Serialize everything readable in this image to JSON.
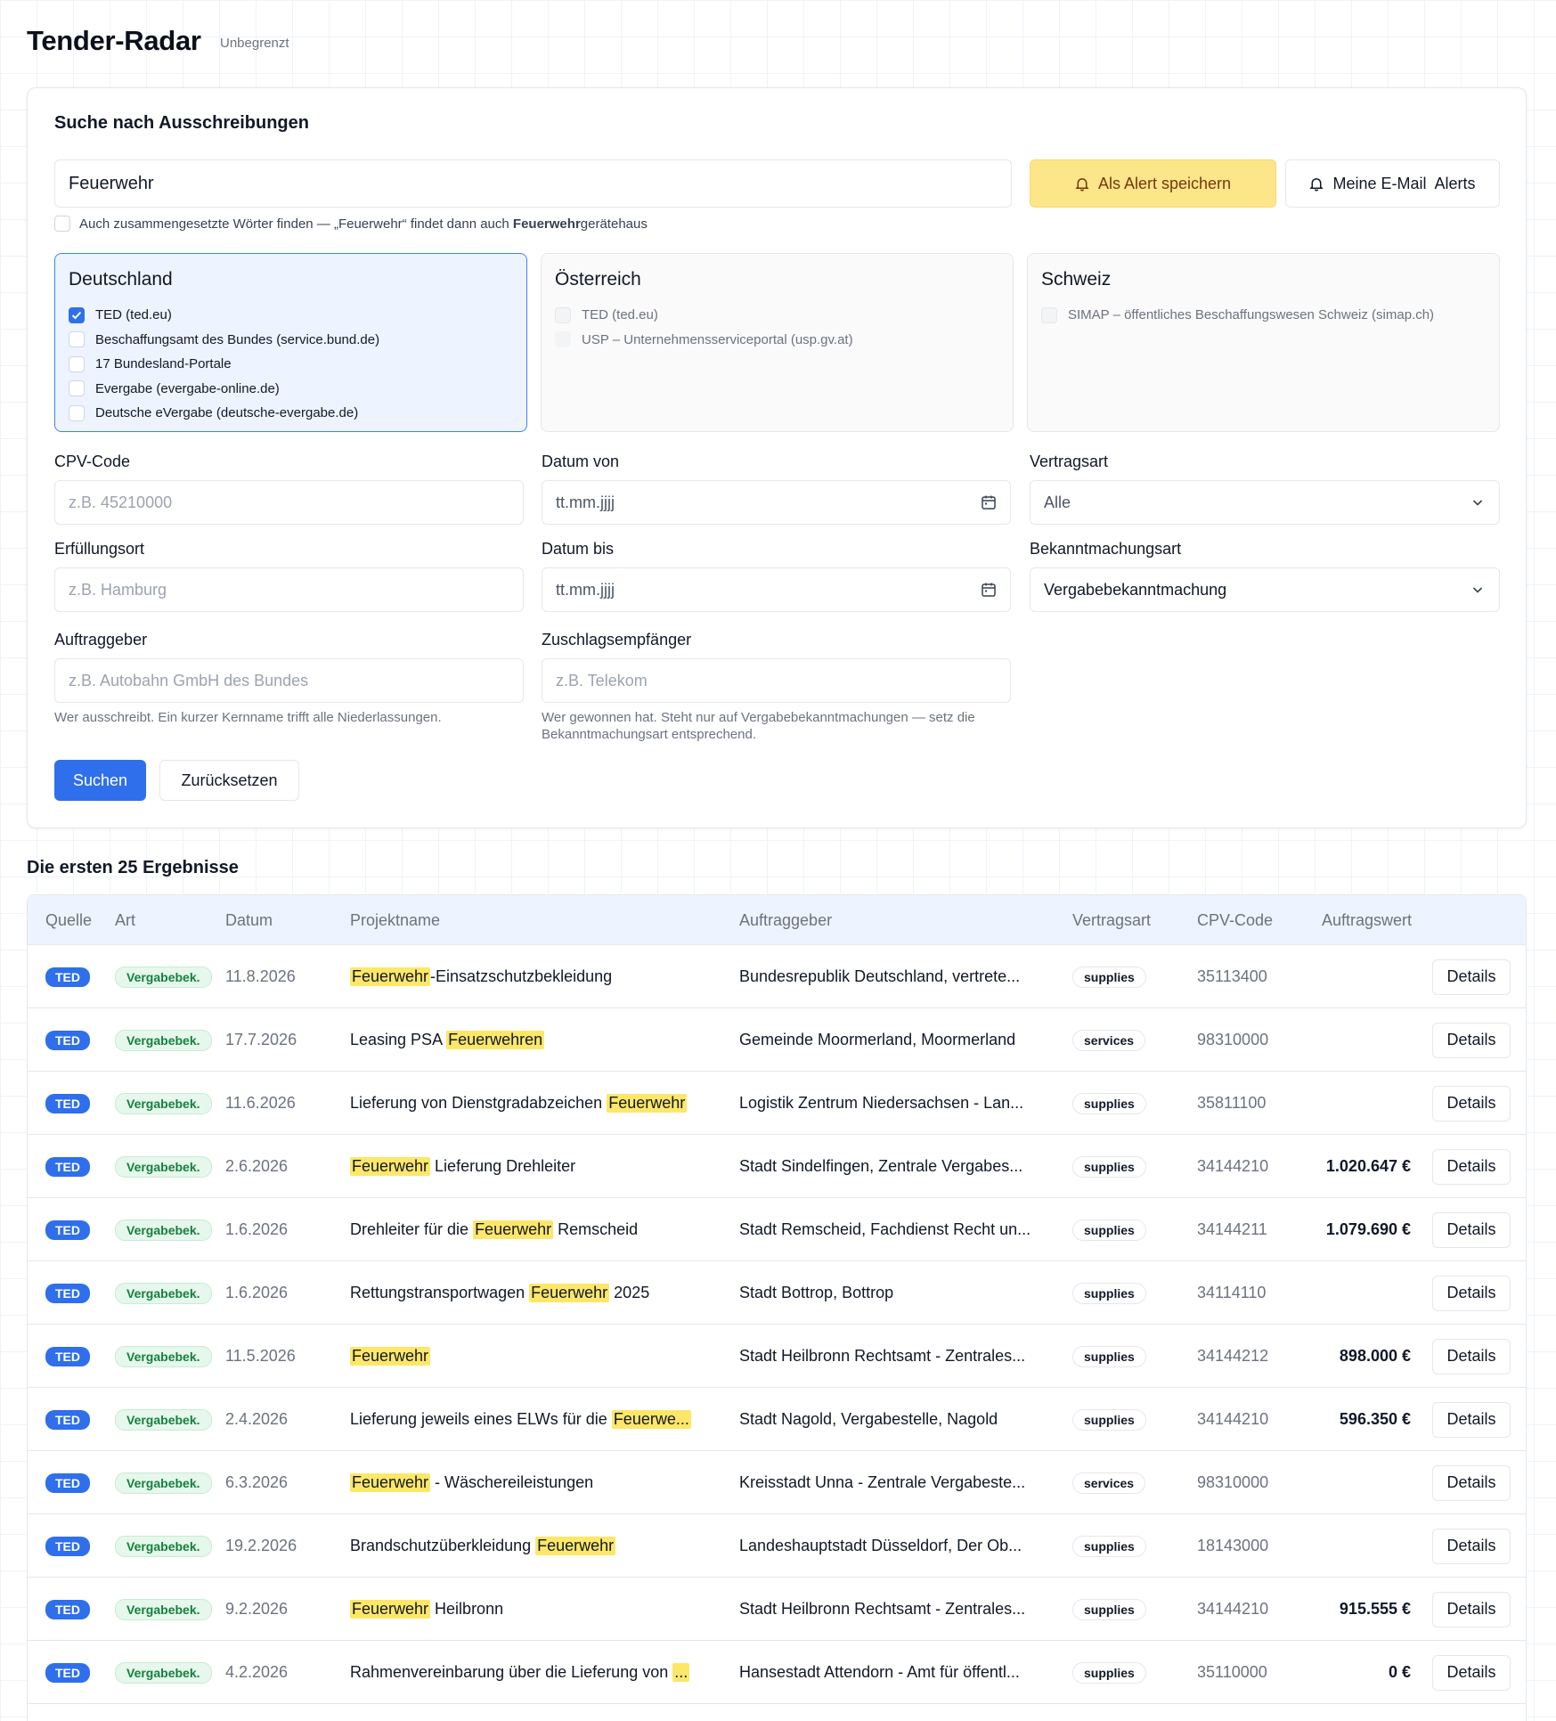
{
  "header": {
    "title": "Tender-Radar",
    "plan": "Unbegrenzt"
  },
  "search": {
    "heading": "Suche nach Ausschreibungen",
    "query": "Feuerwehr",
    "alert_button": "Als Alert speichern",
    "email_alerts_button": "Meine E-Mail  Alerts",
    "compound_label_pre": "Auch zusammengesetzte Wörter finden — „Feuerwehr“ findet dann auch ",
    "compound_label_bold": "Feuerwehr",
    "compound_label_post": "gerätehaus",
    "compound_checked": false
  },
  "countries": [
    {
      "name": "Deutschland",
      "active": true,
      "sources": [
        {
          "label": "TED (ted.eu)",
          "checked": true
        },
        {
          "label": "Beschaffungsamt des Bundes (service.bund.de)",
          "checked": false
        },
        {
          "label": "17 Bundesland-Portale",
          "checked": false
        },
        {
          "label": "Evergabe (evergabe-online.de)",
          "checked": false
        },
        {
          "label": "Deutsche eVergabe (deutsche-evergabe.de)",
          "checked": false
        }
      ]
    },
    {
      "name": "Österreich",
      "active": false,
      "sources": [
        {
          "label": "TED (ted.eu)",
          "checked": false
        },
        {
          "label": "USP – Unternehmensserviceportal (usp.gv.at)",
          "checked": false
        }
      ]
    },
    {
      "name": "Schweiz",
      "active": false,
      "sources": [
        {
          "label": "SIMAP – öffentliches Beschaffungswesen Schweiz (simap.ch)",
          "checked": false
        }
      ]
    }
  ],
  "fields": {
    "cpv": {
      "label": "CPV-Code",
      "placeholder": "z.B. 45210000"
    },
    "date_from": {
      "label": "Datum von",
      "placeholder": "tt.mm.jjjj"
    },
    "contract_type": {
      "label": "Vertragsart",
      "value": "Alle"
    },
    "place": {
      "label": "Erfüllungsort",
      "placeholder": "z.B. Hamburg"
    },
    "date_to": {
      "label": "Datum bis",
      "placeholder": "tt.mm.jjjj"
    },
    "notice_type": {
      "label": "Bekanntmachungsart",
      "value": "Vergabebekanntmachung"
    },
    "buyer": {
      "label": "Auftraggeber",
      "placeholder": "z.B. Autobahn GmbH des Bundes",
      "help": "Wer ausschreibt. Ein kurzer Kernname trifft alle Niederlassungen."
    },
    "winner": {
      "label": "Zuschlagsempfänger",
      "placeholder": "z.B. Telekom",
      "help": "Wer gewonnen hat. Steht nur auf Vergabebekanntmachungen — setz die Bekanntmachungsart entsprechend."
    }
  },
  "actions": {
    "search": "Suchen",
    "reset": "Zurücksetzen"
  },
  "results": {
    "heading": "Die ersten 25 Ergebnisse",
    "columns": [
      "Quelle",
      "Art",
      "Datum",
      "Projektname",
      "Auftraggeber",
      "Vertragsart",
      "CPV-Code",
      "Auftragswert"
    ],
    "details_label": "Details",
    "rows": [
      {
        "source": "TED",
        "type": "Vergabebek.",
        "date": "11.8.2026",
        "project": [
          {
            "t": "Feuerwehr",
            "h": true
          },
          {
            "t": "-Einsatzschutzbekleidung",
            "h": false
          }
        ],
        "buyer": "Bundesrepublik Deutschland, vertrete...",
        "contract": "supplies",
        "cpv": "35113400",
        "value": ""
      },
      {
        "source": "TED",
        "type": "Vergabebek.",
        "date": "17.7.2026",
        "project": [
          {
            "t": "Leasing PSA ",
            "h": false
          },
          {
            "t": "Feuerwehren",
            "h": true
          }
        ],
        "buyer": "Gemeinde Moormerland, Moormerland",
        "contract": "services",
        "cpv": "98310000",
        "value": ""
      },
      {
        "source": "TED",
        "type": "Vergabebek.",
        "date": "11.6.2026",
        "project": [
          {
            "t": "Lieferung von Dienstgradabzeichen ",
            "h": false
          },
          {
            "t": "Feuerwehr",
            "h": true
          }
        ],
        "buyer": "Logistik Zentrum Niedersachsen - Lan...",
        "contract": "supplies",
        "cpv": "35811100",
        "value": ""
      },
      {
        "source": "TED",
        "type": "Vergabebek.",
        "date": "2.6.2026",
        "project": [
          {
            "t": "Feuerwehr",
            "h": true
          },
          {
            "t": " Lieferung Drehleiter",
            "h": false
          }
        ],
        "buyer": "Stadt Sindelfingen, Zentrale Vergabes...",
        "contract": "supplies",
        "cpv": "34144210",
        "value": "1.020.647 €"
      },
      {
        "source": "TED",
        "type": "Vergabebek.",
        "date": "1.6.2026",
        "project": [
          {
            "t": "Drehleiter für die ",
            "h": false
          },
          {
            "t": "Feuerwehr",
            "h": true
          },
          {
            "t": " Remscheid",
            "h": false
          }
        ],
        "buyer": "Stadt Remscheid, Fachdienst Recht un...",
        "contract": "supplies",
        "cpv": "34144211",
        "value": "1.079.690 €"
      },
      {
        "source": "TED",
        "type": "Vergabebek.",
        "date": "1.6.2026",
        "project": [
          {
            "t": "Rettungstransportwagen ",
            "h": false
          },
          {
            "t": "Feuerwehr",
            "h": true
          },
          {
            "t": " 2025",
            "h": false
          }
        ],
        "buyer": "Stadt Bottrop, Bottrop",
        "contract": "supplies",
        "cpv": "34114110",
        "value": ""
      },
      {
        "source": "TED",
        "type": "Vergabebek.",
        "date": "11.5.2026",
        "project": [
          {
            "t": "Feuerwehr",
            "h": true
          }
        ],
        "buyer": "Stadt Heilbronn Rechtsamt - Zentrales...",
        "contract": "supplies",
        "cpv": "34144212",
        "value": "898.000 €"
      },
      {
        "source": "TED",
        "type": "Vergabebek.",
        "date": "2.4.2026",
        "project": [
          {
            "t": "Lieferung jeweils eines ELWs für die ",
            "h": false
          },
          {
            "t": "Feuerwe...",
            "h": true
          }
        ],
        "buyer": "Stadt Nagold, Vergabestelle, Nagold",
        "contract": "supplies",
        "cpv": "34144210",
        "value": "596.350 €"
      },
      {
        "source": "TED",
        "type": "Vergabebek.",
        "date": "6.3.2026",
        "project": [
          {
            "t": "Feuerwehr",
            "h": true
          },
          {
            "t": " - Wäschereileistungen",
            "h": false
          }
        ],
        "buyer": "Kreisstadt Unna - Zentrale Vergabeste...",
        "contract": "services",
        "cpv": "98310000",
        "value": ""
      },
      {
        "source": "TED",
        "type": "Vergabebek.",
        "date": "19.2.2026",
        "project": [
          {
            "t": "Brandschutzüberkleidung ",
            "h": false
          },
          {
            "t": "Feuerwehr",
            "h": true
          }
        ],
        "buyer": "Landeshauptstadt Düsseldorf, Der Ob...",
        "contract": "supplies",
        "cpv": "18143000",
        "value": ""
      },
      {
        "source": "TED",
        "type": "Vergabebek.",
        "date": "9.2.2026",
        "project": [
          {
            "t": "Feuerwehr",
            "h": true
          },
          {
            "t": " Heilbronn",
            "h": false
          }
        ],
        "buyer": "Stadt Heilbronn Rechtsamt - Zentrales...",
        "contract": "supplies",
        "cpv": "34144210",
        "value": "915.555 €"
      },
      {
        "source": "TED",
        "type": "Vergabebek.",
        "date": "4.2.2026",
        "project": [
          {
            "t": "Rahmenvereinbarung über die Lieferung von ",
            "h": false
          },
          {
            "t": "...",
            "h": true
          }
        ],
        "buyer": "Hansestadt Attendorn - Amt für öffentl...",
        "contract": "supplies",
        "cpv": "35110000",
        "value": "0 €"
      }
    ]
  }
}
